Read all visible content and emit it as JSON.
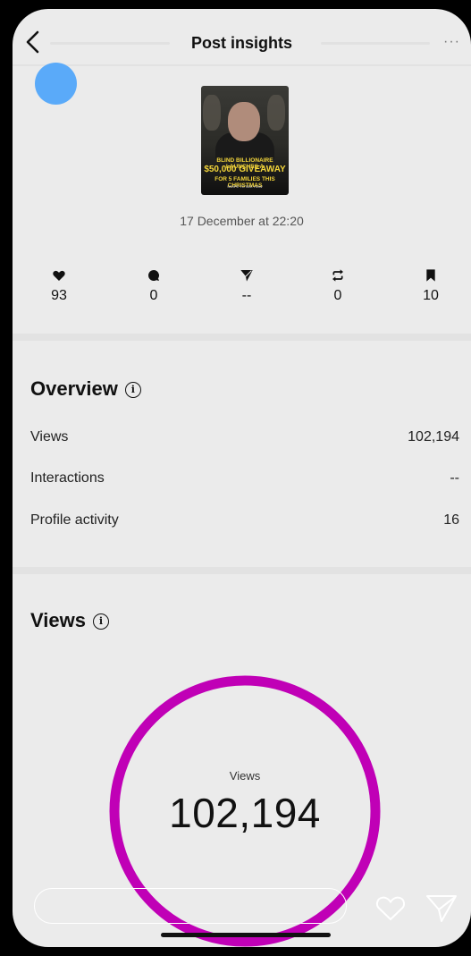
{
  "header": {
    "title": "Post insights",
    "more": "···"
  },
  "post": {
    "thumb_line1": "BLIND BILLIONAIRE LAUNCHES A",
    "thumb_line2": "$50,000 GIVEAWAY",
    "thumb_line3": "FOR 5 FAMILIES THIS CHRISTMAS",
    "thumb_line4": "SWIPE TO SEE HOW",
    "date": "17 December at 22:20"
  },
  "stats": [
    {
      "icon": "heart-icon",
      "value": "93"
    },
    {
      "icon": "comment-icon",
      "value": "0"
    },
    {
      "icon": "send-icon",
      "value": "--"
    },
    {
      "icon": "repost-icon",
      "value": "0"
    },
    {
      "icon": "bookmark-icon",
      "value": "10"
    }
  ],
  "overview": {
    "title": "Overview",
    "rows": [
      {
        "label": "Views",
        "value": "102,194"
      },
      {
        "label": "Interactions",
        "value": "--"
      },
      {
        "label": "Profile activity",
        "value": "16"
      }
    ]
  },
  "views": {
    "title": "Views",
    "ring_label": "Views",
    "ring_value": "102,194",
    "ring_color": "#c000b6"
  },
  "colors": {
    "background": "#ebebeb",
    "accent_dot": "#5aaaf9"
  }
}
